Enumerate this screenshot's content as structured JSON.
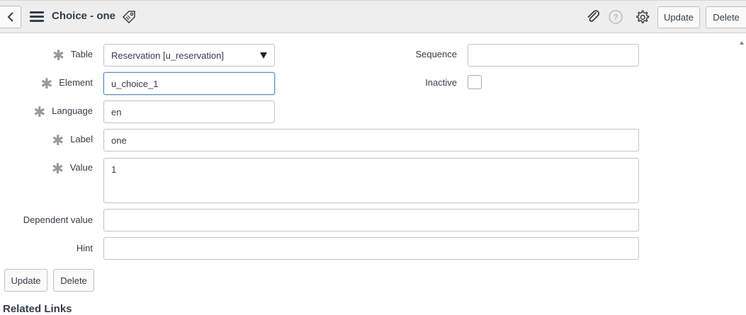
{
  "header": {
    "back_icon": "chevron-left-icon",
    "menu_icon": "hamburger-icon",
    "title": "Choice - one",
    "tag_icon": "tag-icon",
    "attach_icon": "paperclip-icon",
    "help_icon": "question-icon",
    "settings_icon": "gear-icon",
    "update_label": "Update",
    "delete_label": "Delete"
  },
  "form": {
    "table": {
      "label": "Table",
      "value": "Reservation [u_reservation]",
      "required": true
    },
    "element": {
      "label": "Element",
      "value": "u_choice_1",
      "required": true
    },
    "language": {
      "label": "Language",
      "value": "en",
      "required": true
    },
    "label": {
      "label": "Label",
      "value": "one",
      "required": true
    },
    "value": {
      "label": "Value",
      "value": "1",
      "required": true
    },
    "dependent_value": {
      "label": "Dependent value",
      "value": ""
    },
    "hint": {
      "label": "Hint",
      "value": ""
    },
    "sequence": {
      "label": "Sequence",
      "value": ""
    },
    "inactive": {
      "label": "Inactive",
      "checked": false
    }
  },
  "footer": {
    "update_label": "Update",
    "delete_label": "Delete",
    "related_links": "Related Links"
  },
  "colors": {
    "header_bg": "#eeeeee",
    "focus_border": "#5d90c5",
    "text": "#343d47"
  }
}
